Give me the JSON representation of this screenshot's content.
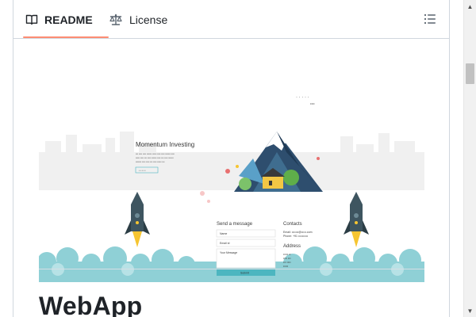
{
  "tabs": [
    {
      "label": "README",
      "icon": "book-icon",
      "active": true
    },
    {
      "label": "License",
      "icon": "law-scale-icon",
      "active": false
    }
  ],
  "outline_icon": "list-unordered-icon",
  "readme": {
    "heading": "WebApp",
    "banner": {
      "nav_dots": "· · · · ·",
      "nav_sub": "••••",
      "hero_title": "Momentum Investing",
      "hero_lines": [
        "••• •••• •••• •••••• ••••• •••• •••• •••••• ••••",
        "••••• •••• ••• •••• •••••• •••• ••• •••• ••••••",
        "••••••• •••• •••• ••• •••• ••••• •••"
      ],
      "hero_button": "• • • • •",
      "send_message_title": "Send a message",
      "field_name": "Name",
      "field_email": "Email id",
      "field_message": "Your Message",
      "submit_label": "Submit",
      "contacts_title": "Contacts",
      "contact_email": "Email: •••••••@•••••.com",
      "contact_phone": "Phone: +91 ••••••••••",
      "address_title": "Address",
      "address_lines": [
        "••••• ••",
        "•••• •••",
        "••• ••••",
        "•••••"
      ]
    }
  },
  "colors": {
    "tab_underline": "#fd8c73",
    "border": "#d0d7de",
    "cloud": "#8fd0d6",
    "rocket_body": "#3e5560",
    "rocket_flame": "#f6c531",
    "mountain": "#2e4e6e"
  }
}
